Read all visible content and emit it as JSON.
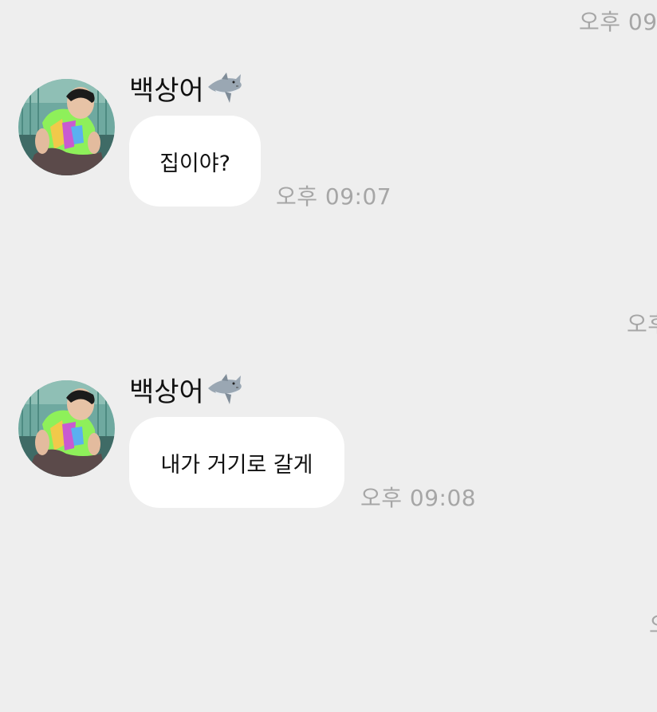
{
  "timestamps": {
    "top_right": "오후 09",
    "mid_right": "오후",
    "bottom_right": "오"
  },
  "messages": [
    {
      "sender": "백상어",
      "sender_icon": "shark-icon",
      "text": "집이야?",
      "time": "오후 09:07"
    },
    {
      "sender": "백상어",
      "sender_icon": "shark-icon",
      "text": "내가 거기로 갈게",
      "time": "오후 09:08"
    }
  ],
  "colors": {
    "background": "#eeeeee",
    "bubble": "#ffffff",
    "timestamp": "#a6a6a6",
    "text": "#111111"
  }
}
